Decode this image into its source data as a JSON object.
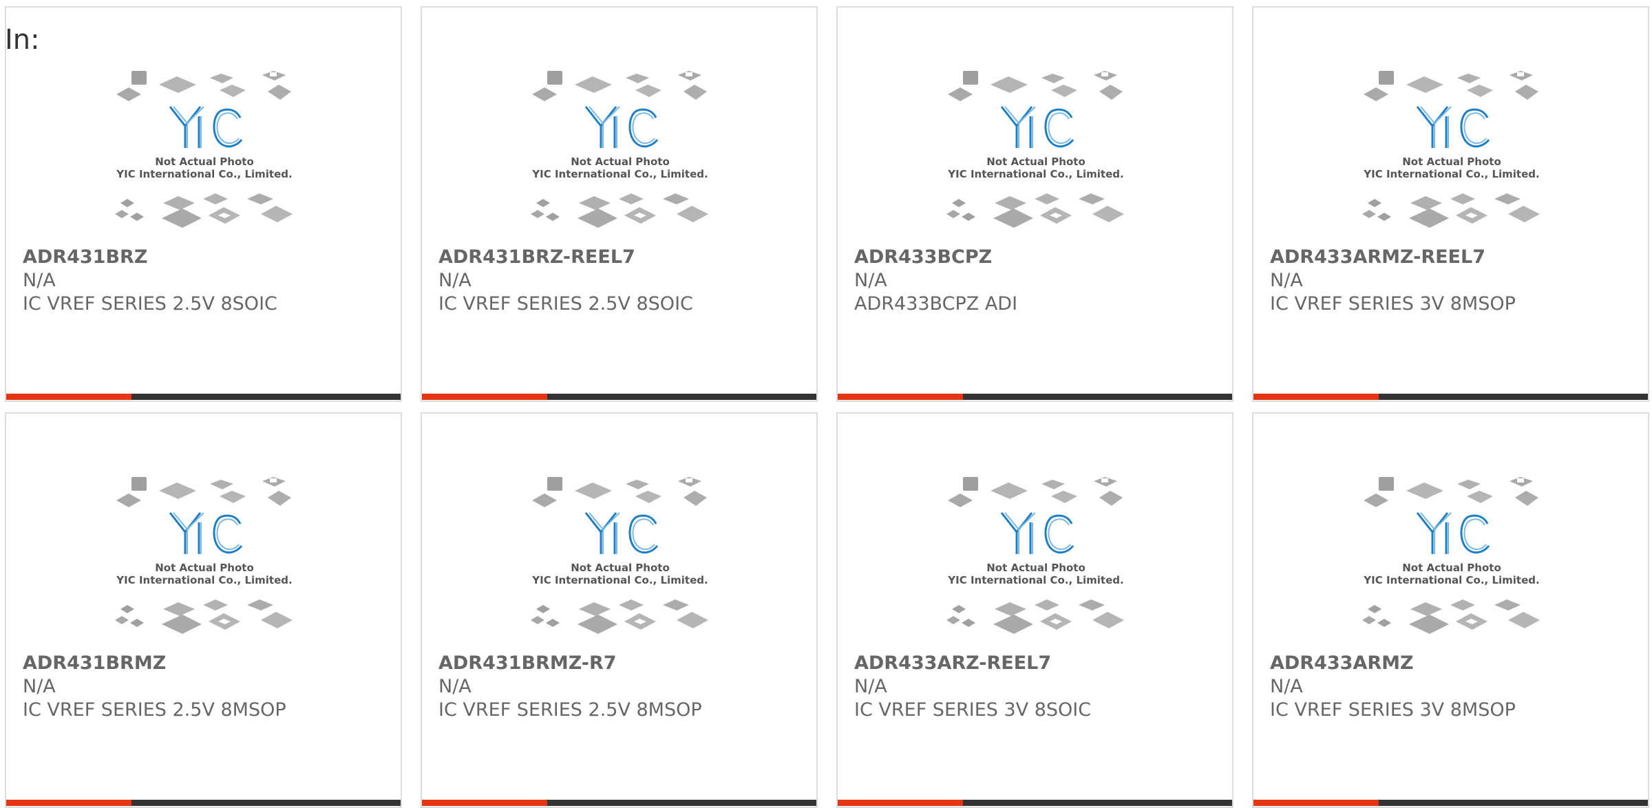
{
  "header": {
    "label": "In:"
  },
  "placeholder_image": {
    "line1": "Not Actual Photo",
    "line2": "YIC International Co., Limited.",
    "logo_text": "YIC"
  },
  "colors": {
    "accent": "#e83511",
    "bar_dark": "#333333",
    "logo_blue": "#1f7fc4",
    "text_gray": "#666666"
  },
  "products": [
    {
      "part": "ADR431BRZ",
      "mfr": "N/A",
      "desc": "IC VREF SERIES 2.5V 8SOIC"
    },
    {
      "part": "ADR431BRZ-REEL7",
      "mfr": "N/A",
      "desc": "IC VREF SERIES 2.5V 8SOIC"
    },
    {
      "part": "ADR433BCPZ",
      "mfr": "N/A",
      "desc": "ADR433BCPZ ADI"
    },
    {
      "part": "ADR433ARMZ-REEL7",
      "mfr": "N/A",
      "desc": "IC VREF SERIES 3V 8MSOP"
    },
    {
      "part": "ADR431BRMZ",
      "mfr": "N/A",
      "desc": "IC VREF SERIES 2.5V 8MSOP"
    },
    {
      "part": "ADR431BRMZ-R7",
      "mfr": "N/A",
      "desc": "IC VREF SERIES 2.5V 8MSOP"
    },
    {
      "part": "ADR433ARZ-REEL7",
      "mfr": "N/A",
      "desc": "IC VREF SERIES 3V 8SOIC"
    },
    {
      "part": "ADR433ARMZ",
      "mfr": "N/A",
      "desc": "IC VREF SERIES 3V 8MSOP"
    }
  ]
}
